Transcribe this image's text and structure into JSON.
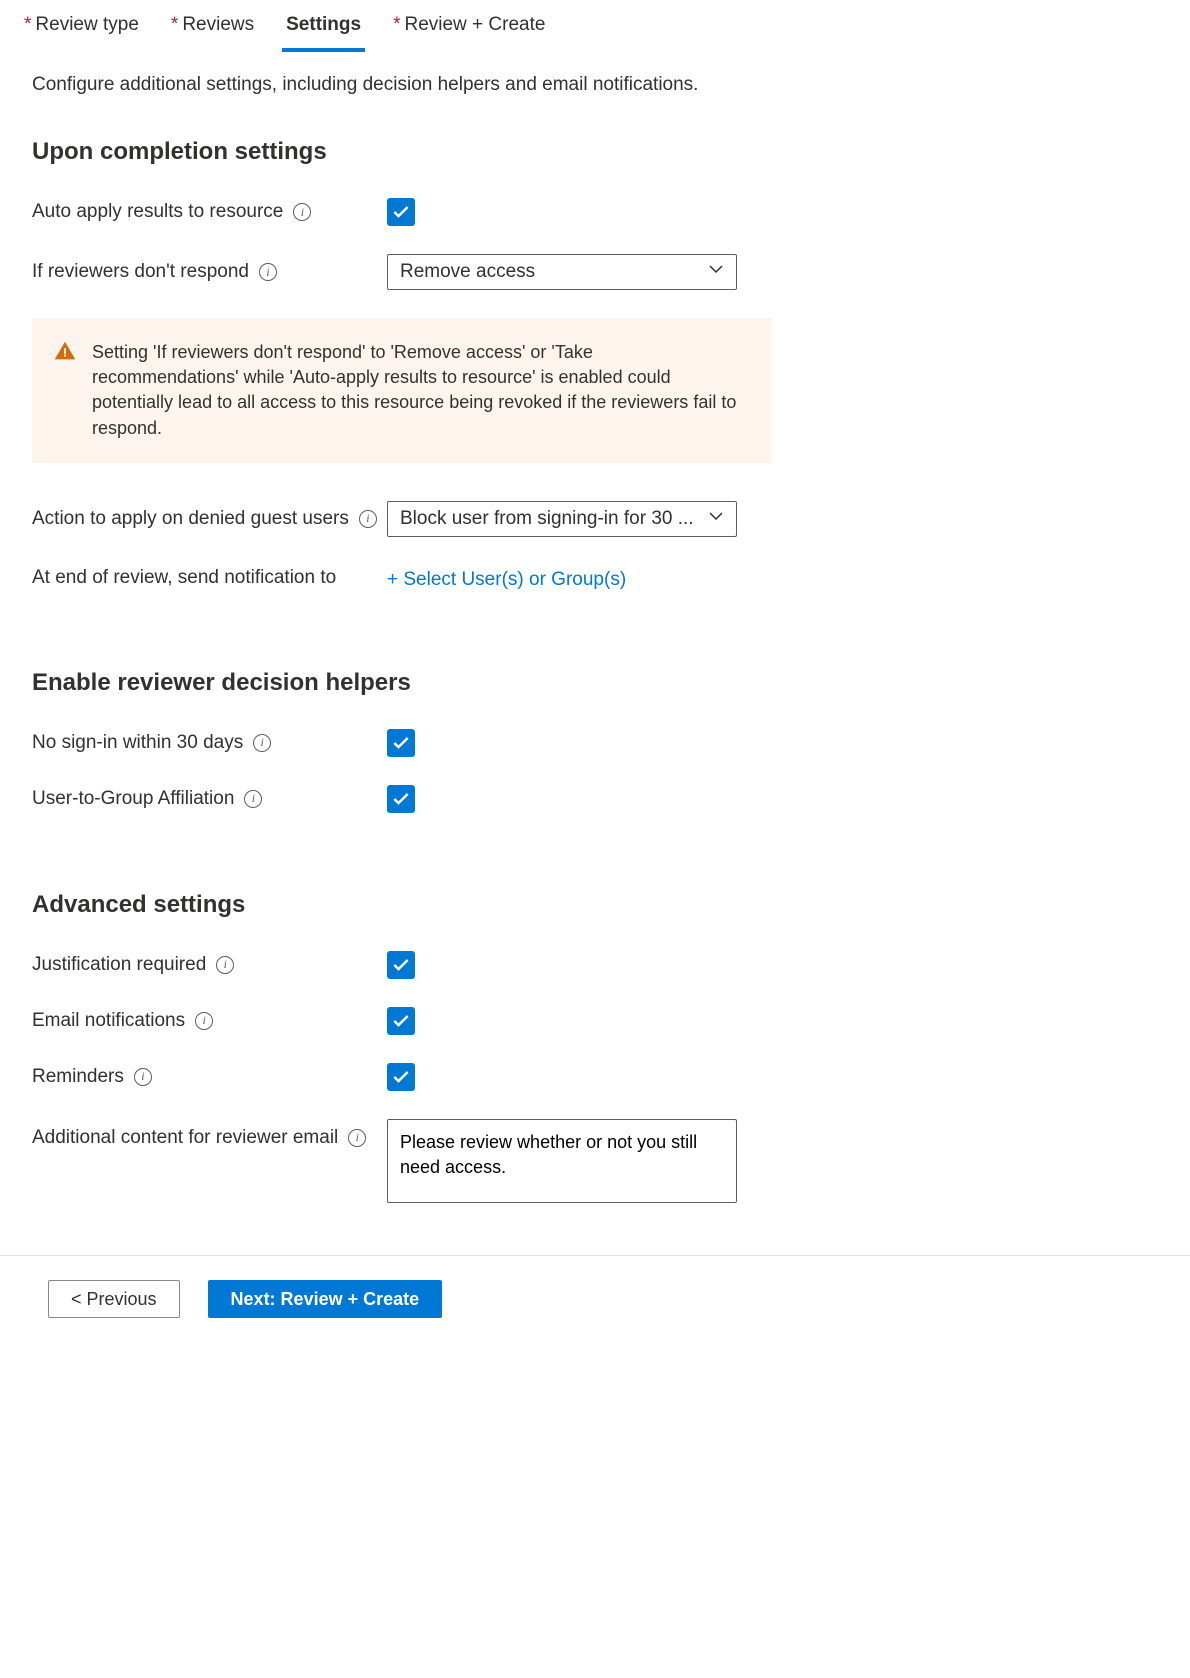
{
  "tabs": {
    "review_type": "Review type",
    "reviews": "Reviews",
    "settings": "Settings",
    "review_create": "Review + Create"
  },
  "intro": "Configure additional settings, including decision helpers and email notifications.",
  "sections": {
    "completion": {
      "heading": "Upon completion settings",
      "auto_apply": {
        "label": "Auto apply results to resource",
        "checked": true
      },
      "no_respond": {
        "label": "If reviewers don't respond",
        "value": "Remove access"
      },
      "warning": "Setting 'If reviewers don't respond' to 'Remove access' or 'Take recommendations' while 'Auto-apply results to resource' is enabled could potentially lead to all access to this resource being revoked if the reviewers fail to respond.",
      "denied_guest": {
        "label": "Action to apply on denied guest users",
        "value": "Block user from signing-in for 30 ..."
      },
      "notify": {
        "label": "At end of review, send notification to",
        "link": "+ Select User(s) or Group(s)"
      }
    },
    "helpers": {
      "heading": "Enable reviewer decision helpers",
      "no_signin": {
        "label": "No sign-in within 30 days",
        "checked": true
      },
      "affiliation": {
        "label": "User-to-Group Affiliation",
        "checked": true
      }
    },
    "advanced": {
      "heading": "Advanced settings",
      "justification": {
        "label": "Justification required",
        "checked": true
      },
      "email": {
        "label": "Email notifications",
        "checked": true
      },
      "reminders": {
        "label": "Reminders",
        "checked": true
      },
      "additional": {
        "label": "Additional content for reviewer email",
        "value": "Please review whether or not you still need access."
      }
    }
  },
  "footer": {
    "previous": "< Previous",
    "next": "Next: Review + Create"
  }
}
